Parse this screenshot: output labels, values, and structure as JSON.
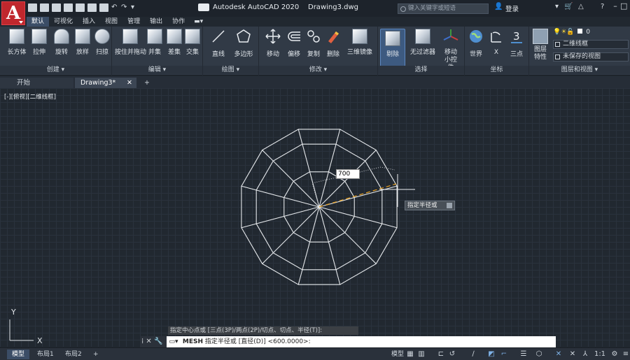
{
  "app": {
    "title": "Autodesk AutoCAD 2020",
    "document": "Drawing3.dwg",
    "search_placeholder": "键入关键字或短语",
    "login": "登录"
  },
  "ribbon_tabs": [
    "默认",
    "可视化",
    "插入",
    "视图",
    "管理",
    "输出",
    "协作"
  ],
  "ribbon_panels": [
    {
      "label": "创建 ▾",
      "tools": [
        "长方体",
        "拉伸",
        "旋转",
        "放样",
        "扫掠"
      ]
    },
    {
      "label": "编辑 ▾",
      "tools": [
        "按住并拖动",
        "并集",
        "差集",
        "交集"
      ]
    },
    {
      "label": "绘图 ▾",
      "tools": [
        "直线",
        "多边形"
      ]
    },
    {
      "label": "修改 ▾",
      "tools": [
        "移动",
        "偏移",
        "复制",
        "删除",
        "三维镜像"
      ]
    },
    {
      "label": "选择",
      "tools": [
        "剔除",
        "无过滤器",
        "移动小控件"
      ]
    },
    {
      "label": "坐标",
      "tools": [
        "世界",
        "X",
        "三点"
      ]
    },
    {
      "label": "图层和视图 ▾",
      "tools": [
        "图层特性"
      ]
    }
  ],
  "layers": {
    "layer_value": "0",
    "visual_style": "二维线框",
    "named_view": "未保存的视图"
  },
  "doc_tabs": {
    "start": "开始",
    "drawing": "Drawing3*",
    "add": "+"
  },
  "viewport_label": "[-][俯视][二维线框]",
  "dynamic_input": {
    "value": "700",
    "prompt": "指定半径或"
  },
  "command": {
    "history": "指定中心点或 [三点(3P)/两点(2P)/切点、切点、半径(T)]:",
    "prefix": "MESH",
    "prompt": "指定半径或 [直径(D)] <600.0000>:"
  },
  "layout_tabs": [
    "模型",
    "布局1",
    "布局2",
    "+"
  ],
  "status": {
    "model_label": "模型",
    "scale": "1:1"
  },
  "colors": {
    "accent": "#3b4d66",
    "canvas": "#212830",
    "logo": "#c0272d",
    "tracking": "#e0a020"
  }
}
